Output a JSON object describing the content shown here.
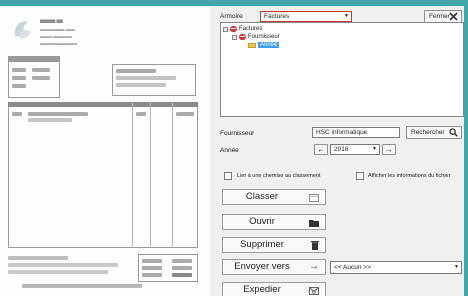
{
  "panel": {
    "armoire_label": "Armoire",
    "armoire_value": "Factures",
    "close_label": "Fermer",
    "tree": [
      {
        "label": "Factures",
        "icon": "red-drawer-icon",
        "expander": "-"
      },
      {
        "label": "Fournisseur",
        "icon": "red-drawer-icon",
        "expander": "-"
      },
      {
        "label": "Année",
        "icon": "folder-icon",
        "selected": true
      }
    ],
    "fournisseur_label": "Fournisseur",
    "fournisseur_value": "HSC informatique",
    "search_label": "Rechercher",
    "annee_label": "Année",
    "annee_value": "2016",
    "link_chemise_label": "Lier à une chemise au classement",
    "show_info_label": "Afficher les informations du fichier",
    "buttons": {
      "classer": "Classer",
      "ouvrir": "Ouvrir",
      "supprimer": "Supprimer",
      "envoyer": "Envoyer vers",
      "expedier": "Expedier"
    },
    "envoyer_target": "<< Aucun >>"
  },
  "colors": {
    "frame": "#3fa7a8",
    "selection": "#3fa0e8",
    "armoire_border": "#c0392b"
  }
}
